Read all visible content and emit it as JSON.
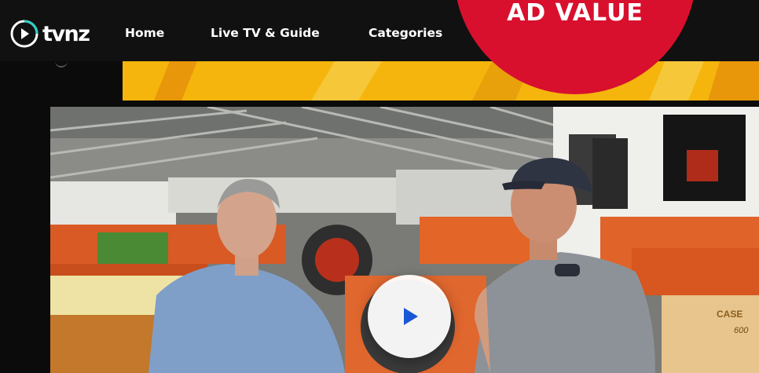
{
  "header": {
    "brand": "tvnz",
    "nav": [
      {
        "label": "Home"
      },
      {
        "label": "Live TV & Guide"
      },
      {
        "label": "Categories"
      }
    ]
  },
  "badge": {
    "text": "AD VALUE",
    "color": "#d8102e"
  },
  "player": {
    "play_icon": "play-icon",
    "accent": "#1a57d6"
  },
  "video_frame": {
    "sign_text": "CASE",
    "sign_number": "600"
  },
  "colors": {
    "banner": "#f5b50c",
    "header_bg": "#111111"
  }
}
